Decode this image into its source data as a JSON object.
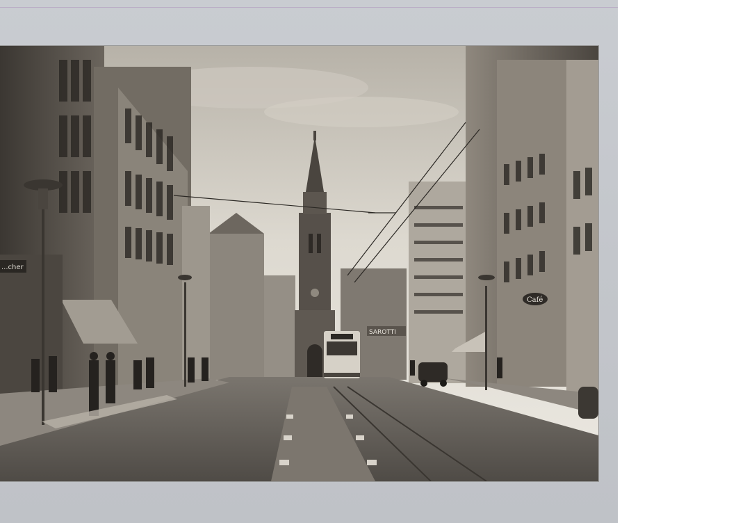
{
  "photo": {
    "description_visible_signs": {
      "shop_sign_left": "...cher",
      "cafe_sign": "Café",
      "tram_destination": "",
      "sarotti_sign": "SAROTTI"
    },
    "colors": {
      "sky_light": "#e6e3dc",
      "sky_dark": "#b9b4aa",
      "building_dark": "#3f3b36",
      "building_mid": "#6e6860",
      "building_light": "#a8a197",
      "road": "#5e5a55",
      "sidewalk": "#8d877f"
    }
  }
}
